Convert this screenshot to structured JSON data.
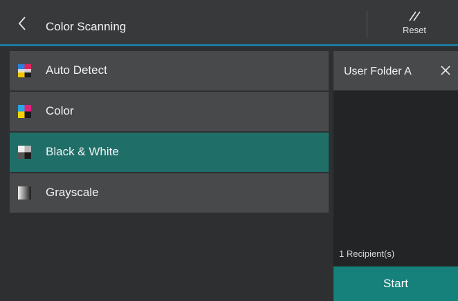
{
  "header": {
    "back_icon": "chevron-left-icon",
    "title": "Color Scanning",
    "reset_icon": "reset-slash-icon",
    "reset_label": "Reset",
    "accent_color": "#1e7aa0"
  },
  "options": [
    {
      "label": "Auto Detect",
      "icon": "auto-detect-icon",
      "selected": false
    },
    {
      "label": "Color",
      "icon": "color-icon",
      "selected": false
    },
    {
      "label": "Black & White",
      "icon": "black-white-icon",
      "selected": true
    },
    {
      "label": "Grayscale",
      "icon": "grayscale-icon",
      "selected": false
    }
  ],
  "recipients": {
    "name": "User Folder A",
    "remove_icon": "close-icon",
    "count_label": "1 Recipient(s)",
    "start_label": "Start",
    "start_color": "#16807a"
  },
  "colors": {
    "selected": "#1f6f68",
    "option_bg": "#48494b",
    "background": "#2e2f31"
  }
}
